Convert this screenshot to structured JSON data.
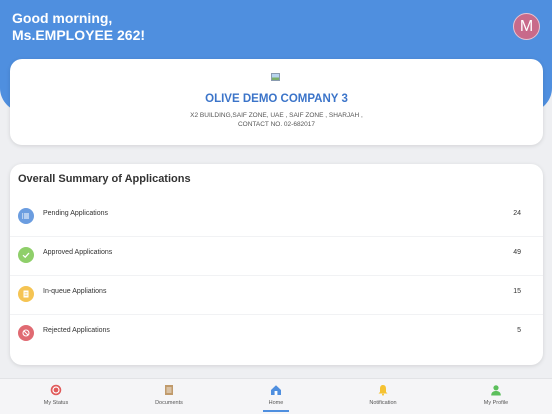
{
  "header": {
    "greeting_line1": "Good morning,",
    "greeting_line2": "Ms.EMPLOYEE 262!",
    "avatar_letter": "M",
    "bg_color": "#4f8fdf"
  },
  "company": {
    "name": "OLIVE DEMO COMPANY 3",
    "address": "X2 BUILDING,SAIF ZONE, UAE , SAIF ZONE , SHARJAH ,",
    "contact": "CONTACT NO. 02-682017"
  },
  "summary": {
    "title": "Overall Summary of Applications",
    "rows": [
      {
        "label": "Pending Applications",
        "count": "24",
        "icon": "list-icon",
        "color": "#6b9de0"
      },
      {
        "label": "Approved Applications",
        "count": "49",
        "icon": "check-icon",
        "color": "#8fcf6a"
      },
      {
        "label": "In-queue Appliations",
        "count": "15",
        "icon": "document-icon",
        "color": "#f5c453"
      },
      {
        "label": "Rejected Applications",
        "count": "5",
        "icon": "ban-icon",
        "color": "#e06a72"
      }
    ]
  },
  "nav": {
    "items": [
      {
        "label": "My Status",
        "icon": "status-icon",
        "color": "#e05a5a"
      },
      {
        "label": "Documents",
        "icon": "documents-icon",
        "color": "#c09a6b"
      },
      {
        "label": "Home",
        "icon": "home-icon",
        "color": "#4f8fdf",
        "active": true
      },
      {
        "label": "Notification",
        "icon": "bell-icon",
        "color": "#f5c232"
      },
      {
        "label": "My Profile",
        "icon": "profile-icon",
        "color": "#5cbf5c"
      }
    ]
  }
}
